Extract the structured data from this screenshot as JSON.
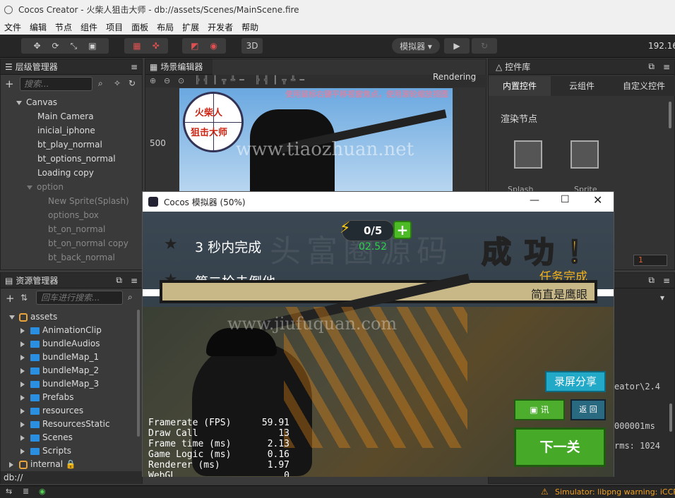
{
  "window": {
    "title": "Cocos Creator - 火柴人狙击大师 - db://assets/Scenes/MainScene.fire"
  },
  "menu": [
    "文件",
    "编辑",
    "节点",
    "组件",
    "项目",
    "面板",
    "布局",
    "扩展",
    "开发者",
    "帮助"
  ],
  "toolbar": {
    "simulator_label": "模拟器 ▾",
    "mode_3d": "3D",
    "ip": "192.16"
  },
  "hierarchy": {
    "title": "层级管理器",
    "search_placeholder": "搜索...",
    "root": "Canvas",
    "items": [
      "Main Camera",
      "inicial_iphone",
      "bt_play_normal",
      "bt_options_normal",
      "Loading copy"
    ],
    "option_node": "option",
    "option_children": [
      "New Sprite(Splash)",
      "options_box",
      "bt_on_normal",
      "bt_on_normal copy",
      "bt_back_normal"
    ]
  },
  "scene": {
    "title": "场景编辑器",
    "rendering": "Rendering",
    "hint": "使用鼠标右键平移视窗焦点，使用滚轮缩放视图",
    "ruler_value": "500",
    "logo_line1": "火柴人",
    "logo_line2": "狙击大师",
    "watermark": "www.tiaozhuan.net"
  },
  "widgets": {
    "title": "控件库",
    "tabs": [
      "内置控件",
      "云组件",
      "自定义控件"
    ],
    "section": "渲染节点",
    "items": [
      "Splash",
      "Sprite"
    ],
    "value": "1"
  },
  "assets": {
    "title": "资源管理器",
    "search_placeholder": "回车进行搜索...",
    "root": "assets",
    "folders": [
      "AnimationClip",
      "bundleAudios",
      "bundleMap_1",
      "bundleMap_2",
      "bundleMap_3",
      "Prefabs",
      "resources",
      "ResourcesStatic",
      "Scenes",
      "Scripts"
    ],
    "internal": "internal",
    "path": "db://"
  },
  "console": {
    "lines": [
      "eator\\2.4",
      "000001ms",
      "rms: 1024"
    ]
  },
  "simulator": {
    "title": "Cocos 模拟器 (50%)",
    "tasks": [
      "3 秒内完成",
      "第二枪击倒他"
    ],
    "energy": "0/5",
    "timer": "02.52",
    "success": "成 功 ！",
    "mission_done": "任务完成",
    "banner": "简直是鹰眼",
    "watermark1": "头富圈源码",
    "watermark2": "www.jiufuquan.com",
    "btn_record": "录屏分享",
    "btn_small1": "▣ 讯",
    "btn_small2": "返 回",
    "btn_next": "下一关",
    "stats": [
      {
        "label": "Framerate (FPS)",
        "value": "59.91"
      },
      {
        "label": "Draw Call",
        "value": "13"
      },
      {
        "label": "Frame time (ms)",
        "value": "2.13"
      },
      {
        "label": "Game Logic (ms)",
        "value": "0.16"
      },
      {
        "label": "Renderer (ms)",
        "value": "1.97"
      },
      {
        "label": "WebGL",
        "value": "0"
      }
    ]
  },
  "status": {
    "warning": "Simulator: libpng warning: iCCP"
  },
  "colors": {
    "accent_green": "#6cc23a",
    "gold": "#f5b21a",
    "banner": "#c8b888"
  }
}
